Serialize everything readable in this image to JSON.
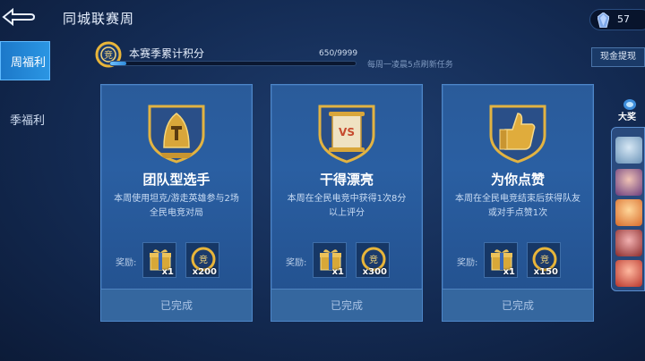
{
  "header": {
    "title": "同城联赛周",
    "currency_amount": "57"
  },
  "nav": {
    "items": [
      {
        "label": "周福利",
        "active": true
      },
      {
        "label": "季福利",
        "active": false
      }
    ]
  },
  "progress": {
    "label": "本赛季累计积分",
    "value_text": "650/9999",
    "fraction": 0.065,
    "refresh_text": "每周一凌晨5点刷新任务",
    "cash_button": "现金提现"
  },
  "cards": [
    {
      "title": "团队型选手",
      "desc": "本周使用坦克/游走英雄参与2场全民电竞对局",
      "reward_label": "奖励:",
      "rewards": [
        {
          "icon": "gift-box-icon",
          "qty": "x1"
        },
        {
          "icon": "coin-token-icon",
          "qty": "x200"
        }
      ],
      "status": "已完成"
    },
    {
      "title": "干得漂亮",
      "desc": "本周在全民电竞中获得1次8分以上评分",
      "reward_label": "奖励:",
      "rewards": [
        {
          "icon": "gift-box-icon",
          "qty": "x1"
        },
        {
          "icon": "coin-token-icon",
          "qty": "x300"
        }
      ],
      "status": "已完成"
    },
    {
      "title": "为你点赞",
      "desc": "本周在全民电竞结束后获得队友或对手点赞1次",
      "reward_label": "奖励:",
      "rewards": [
        {
          "icon": "gift-box-icon",
          "qty": "x1"
        },
        {
          "icon": "coin-token-icon",
          "qty": "x150"
        }
      ],
      "status": "已完成"
    }
  ],
  "rail": {
    "label": "大奖"
  },
  "colors": {
    "accent": "#2b96e3",
    "gold": "#e8b53a",
    "card": "#2a5b9a"
  }
}
